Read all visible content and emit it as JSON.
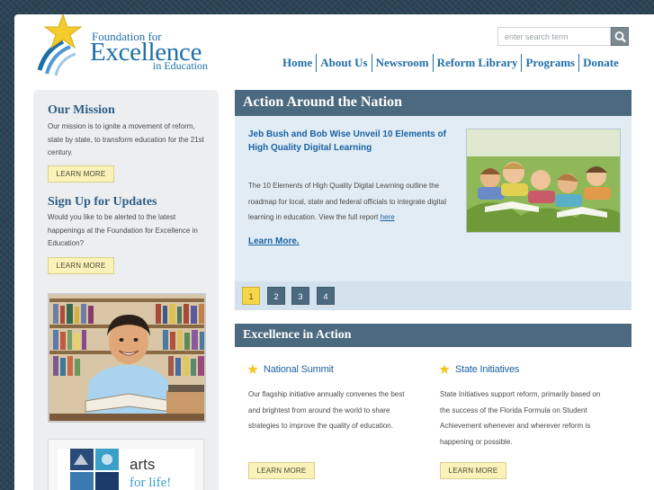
{
  "header": {
    "logo": {
      "line1": "Foundation for",
      "line2": "Excellence",
      "line3": "in Education"
    },
    "search_placeholder": "enter search term",
    "nav": [
      "Home",
      "About Us",
      "Newsroom",
      "Reform Library",
      "Programs",
      "Donate"
    ]
  },
  "sidebar": {
    "mission_title": "Our Mission",
    "mission_text": "Our mission is to ignite a movement of reform, state by state, to transform education for the 21st century.",
    "learn_more": "LEARN MORE",
    "signup_title": "Sign Up for Updates",
    "signup_text": "Would you like to be alerted to the latest happenings at the Foundation for Excellence in Education?",
    "signup_button": "LEARN MORE",
    "arts_line1": "arts",
    "arts_line2": "for life!"
  },
  "action": {
    "title": "Action Around the Nation",
    "feature_title": "Jeb Bush and Bob Wise Unveil 10 Elements of High Quality Digital Learning",
    "feature_body": "The 10 Elements of High Quality Digital Learning outline the roadmap for local, state and federal officials to integrate digital learning in education. View the full report",
    "feature_here": "here",
    "feature_more": "Learn More.",
    "pages": [
      "1",
      "2",
      "3",
      "4"
    ]
  },
  "excellence": {
    "title": "Excellence in Action",
    "summit_title": "National Summit",
    "summit_text": "Our flagship initiative annually convenes the best and brightest from around the world to share strategies to improve the quality of education.",
    "summit_button": "LEARN MORE",
    "states_title": "State Initiatives",
    "states_text": "State Initiatives support reform, primarily based on the success of the Florida Formula on Student Achievement whenever and wherever reform is happening or possible.",
    "states_button": "LEARN MORE"
  },
  "colors": {
    "brand_blue": "#1f6fa8",
    "band": "#4b6a80",
    "button_yellow": "#fbf2b9",
    "pager_active": "#f6d64a"
  }
}
